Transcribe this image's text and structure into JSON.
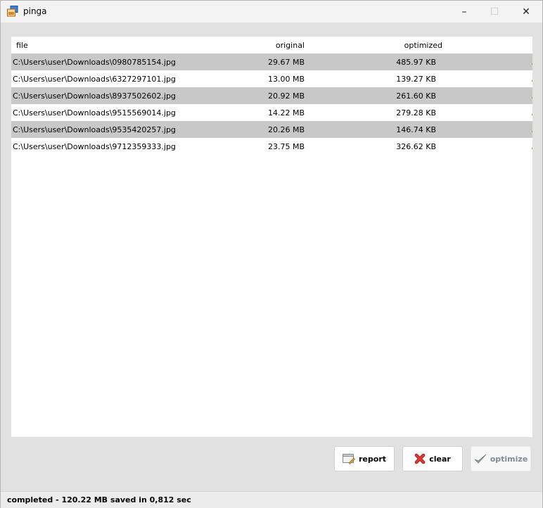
{
  "window": {
    "title": "pinga",
    "minimize": "–",
    "maximize": "☐",
    "close": "✕"
  },
  "table": {
    "headers": {
      "file": "file",
      "original": "original",
      "optimized": "optimized"
    },
    "rows": [
      {
        "file": "C:\\Users\\user\\Downloads\\0980785154.jpg",
        "original": "29.67 MB",
        "optimized": "485.97 KB"
      },
      {
        "file": "C:\\Users\\user\\Downloads\\6327297101.jpg",
        "original": "13.00 MB",
        "optimized": "139.27 KB"
      },
      {
        "file": "C:\\Users\\user\\Downloads\\8937502602.jpg",
        "original": "20.92 MB",
        "optimized": "261.60 KB"
      },
      {
        "file": "C:\\Users\\user\\Downloads\\9515569014.jpg",
        "original": "14.22 MB",
        "optimized": "279.28 KB"
      },
      {
        "file": "C:\\Users\\user\\Downloads\\9535420257.jpg",
        "original": "20.26 MB",
        "optimized": "146.74 KB"
      },
      {
        "file": "C:\\Users\\user\\Downloads\\9712359333.jpg",
        "original": "23.75 MB",
        "optimized": "326.62 KB"
      }
    ]
  },
  "buttons": {
    "report": "report",
    "clear": "clear",
    "optimize": "optimize"
  },
  "status": "completed -  120.22 MB saved in 0,812 sec"
}
